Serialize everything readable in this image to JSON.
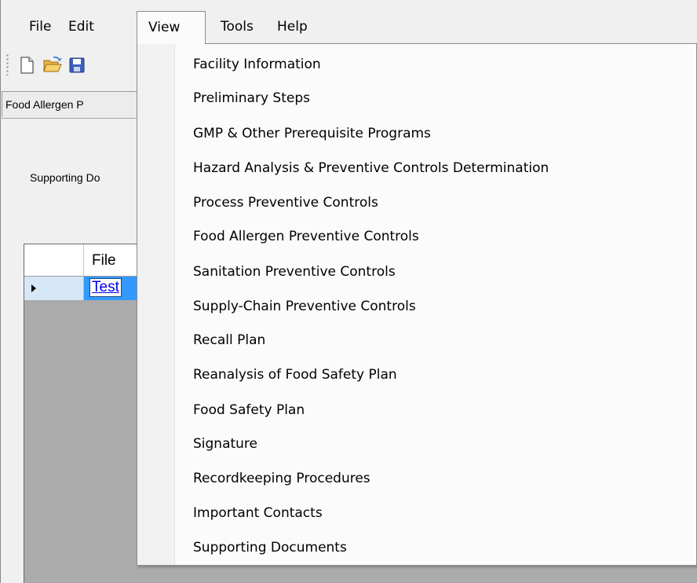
{
  "menubar": {
    "items": [
      {
        "label": "File"
      },
      {
        "label": "Edit"
      },
      {
        "label": "View"
      },
      {
        "label": "Tools"
      },
      {
        "label": "Help"
      }
    ]
  },
  "toolbar": {
    "icons": [
      "new-document-icon",
      "open-folder-icon",
      "save-icon"
    ]
  },
  "tabs": {
    "active_label": "Food Allergen P"
  },
  "panel": {
    "label": "Supporting Do"
  },
  "grid": {
    "column_header": "File",
    "rows": [
      {
        "file": "Test"
      }
    ]
  },
  "view_menu": {
    "items": [
      "Facility Information",
      "Preliminary Steps",
      "GMP & Other Prerequisite Programs",
      "Hazard Analysis & Preventive Controls Determination",
      "Process Preventive Controls",
      "Food Allergen Preventive Controls",
      "Sanitation Preventive Controls",
      "Supply-Chain Preventive Controls",
      "Recall Plan",
      "Reanalysis of Food Safety Plan",
      "Food Safety Plan",
      "Signature",
      "Recordkeeping Procedures",
      "Important Contacts",
      "Supporting Documents"
    ]
  },
  "colors": {
    "selection": "#3399ff",
    "link": "#0000ee",
    "window_bg": "#f0f0f0",
    "grid_bg": "#ababab"
  }
}
